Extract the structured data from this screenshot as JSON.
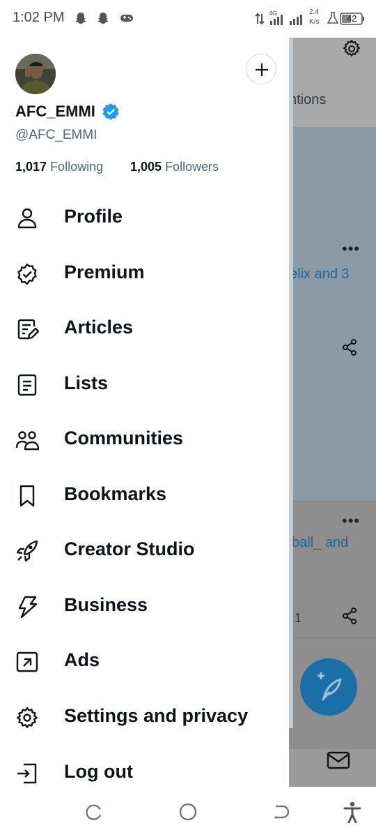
{
  "status_bar": {
    "time": "1:02 PM",
    "net_type": "4G",
    "speed_value": "2.4",
    "speed_unit": "K/s",
    "battery": "42",
    "icons": [
      "snapchat-icon",
      "snapchat-icon",
      "game-controller-icon",
      "data-arrows-icon",
      "signal-icon",
      "signal-icon",
      "lab-flask-icon",
      "battery-icon"
    ]
  },
  "profile": {
    "display_name": "AFC_EMMI",
    "handle": "@AFC_EMMI",
    "following_count": "1,017",
    "following_label": "Following",
    "followers_count": "1,005",
    "followers_label": "Followers",
    "verified_color": "#1d9bf0"
  },
  "menu": {
    "items": [
      {
        "label": "Profile",
        "icon": "person-icon"
      },
      {
        "label": "Premium",
        "icon": "premium-badge-icon"
      },
      {
        "label": "Articles",
        "icon": "article-edit-icon"
      },
      {
        "label": "Lists",
        "icon": "list-icon"
      },
      {
        "label": "Communities",
        "icon": "communities-icon"
      },
      {
        "label": "Bookmarks",
        "icon": "bookmark-icon"
      },
      {
        "label": "Creator Studio",
        "icon": "rocket-icon"
      },
      {
        "label": "Business",
        "icon": "lightning-icon"
      },
      {
        "label": "Ads",
        "icon": "ads-arrow-icon"
      },
      {
        "label": "Settings and privacy",
        "icon": "gear-icon"
      },
      {
        "label": "Log out",
        "icon": "logout-icon"
      }
    ]
  },
  "background": {
    "tab_label": "ntions",
    "post1_text": "elix and 3",
    "post2_text": "ball_ and",
    "post2_count": "1"
  },
  "colors": {
    "accent": "#1d9bf0",
    "fab": "#1a6fa8"
  }
}
